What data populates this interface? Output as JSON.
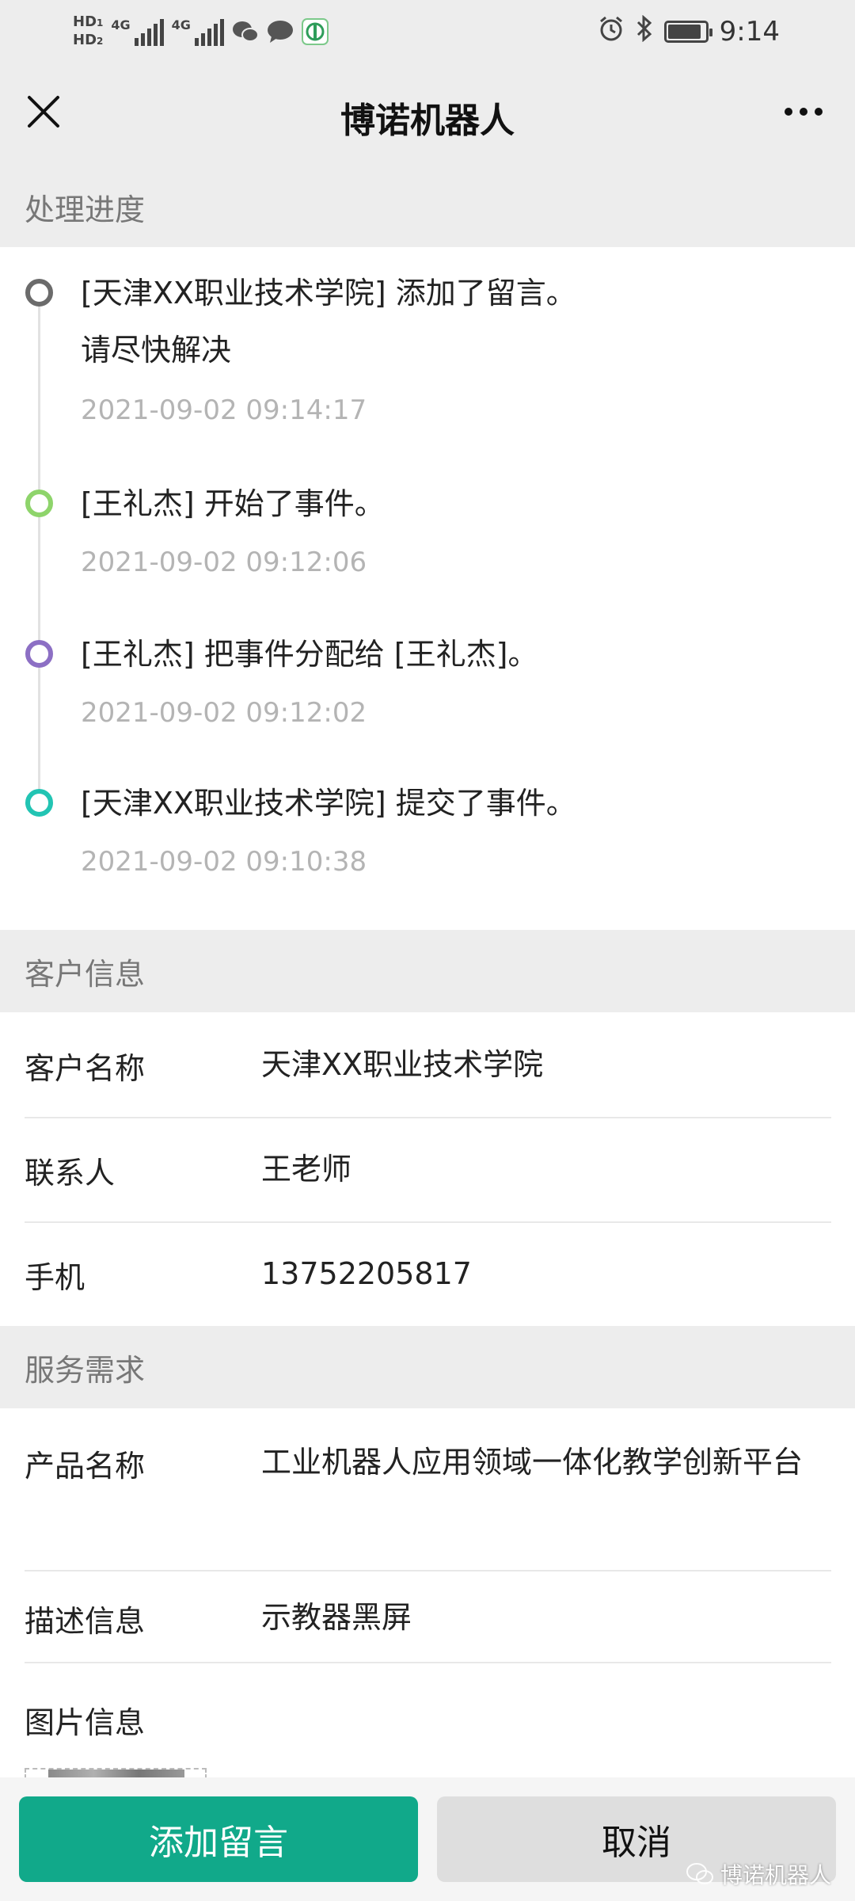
{
  "status_bar": {
    "hd1": "HD",
    "hd1_num": "1",
    "hd2": "HD",
    "hd2_num": "2",
    "net1": "4G",
    "net2": "4G",
    "time": "9:14",
    "battery_level": 0.85,
    "icons": [
      "wechat-icon",
      "message-icon",
      "app-icon",
      "alarm-icon",
      "bluetooth-icon",
      "battery-icon"
    ]
  },
  "nav": {
    "title": "博诺机器人",
    "close_icon": "close-icon",
    "more_icon": "more-icon"
  },
  "progress": {
    "header": "处理进度",
    "items": [
      {
        "text": "[天津XX职业技术学院] 添加了留言。",
        "sub": "请尽快解决",
        "time": "2021-09-02 09:14:17",
        "color": "#6b6b6b"
      },
      {
        "text": "[王礼杰] 开始了事件。",
        "time": "2021-09-02 09:12:06",
        "color": "#8ed46b"
      },
      {
        "text": "[王礼杰] 把事件分配给 [王礼杰]。",
        "time": "2021-09-02 09:12:02",
        "color": "#8c6fc4"
      },
      {
        "text": "[天津XX职业技术学院] 提交了事件。",
        "time": "2021-09-02 09:10:38",
        "color": "#22c4b3"
      }
    ]
  },
  "customer": {
    "header": "客户信息",
    "rows": [
      {
        "label": "客户名称",
        "value": "天津XX职业技术学院"
      },
      {
        "label": "联系人",
        "value": "王老师"
      },
      {
        "label": "手机",
        "value": "13752205817"
      }
    ]
  },
  "service": {
    "header": "服务需求",
    "rows": [
      {
        "label": "产品名称",
        "value": "工业机器人应用领域一体化教学创新平台"
      },
      {
        "label": "描述信息",
        "value": "示教器黑屏"
      },
      {
        "label": "图片信息",
        "value": ""
      }
    ]
  },
  "actions": {
    "add_comment": "添加留言",
    "cancel": "取消",
    "primary_color": "#11a98a"
  },
  "watermark": {
    "text": "博诺机器人"
  }
}
